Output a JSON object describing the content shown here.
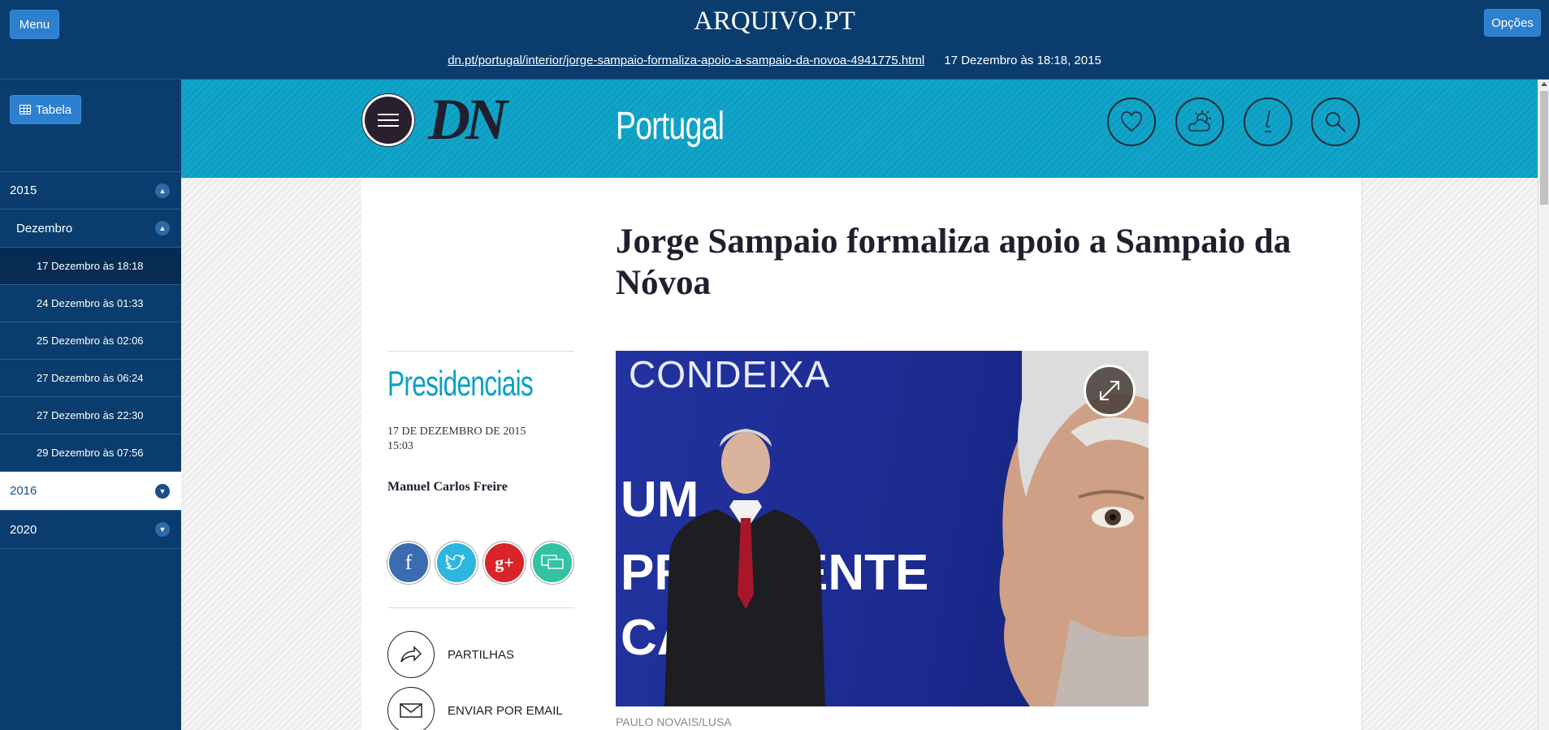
{
  "topbar": {
    "menu_label": "Menu",
    "logo": "ARQUIVO.PT",
    "options_label": "Opções",
    "url": "dn.pt/portugal/interior/jorge-sampaio-formaliza-apoio-a-sampaio-da-novoa-4941775.html",
    "capture_date": "17 Dezembro às 18:18, 2015"
  },
  "sidebar": {
    "table_label": "Tabela",
    "years": [
      {
        "label": "2015"
      },
      {
        "label": "2016"
      },
      {
        "label": "2020"
      }
    ],
    "month": "Dezembro",
    "dates": [
      "17 Dezembro às 18:18",
      "24 Dezembro às 01:33",
      "25 Dezembro às 02:06",
      "27 Dezembro às 06:24",
      "27 Dezembro às 22:30",
      "29 Dezembro às 07:56"
    ]
  },
  "site": {
    "logo": "DN",
    "section": "Portugal",
    "icons": [
      "heart-icon",
      "weather-icon",
      "pen-icon",
      "search-icon"
    ]
  },
  "article": {
    "headline": "Jorge Sampaio formaliza apoio a Sampaio da Nóvoa",
    "category": "Presidenciais",
    "date": "17 DE DEZEMBRO DE 2015",
    "time": "15:03",
    "author": "Manuel Carlos Freire",
    "share_label": "PARTILHAS",
    "email_label": "ENVIAR POR EMAIL",
    "photo_caption": "PAULO NOVAIS/LUSA",
    "photo_text": {
      "line1": "CONDEIXA",
      "line2": "UM",
      "line3": "PR",
      "line4": "ENTE",
      "line5": "CA"
    }
  },
  "colors": {
    "archive_bg": "#0a3d6e",
    "button_blue": "#2d7fd0",
    "dn_cyan": "#0aa1c6",
    "facebook": "#3b6bb0",
    "twitter": "#2cb6e0",
    "google": "#d9242a",
    "comments": "#33c2a3"
  }
}
